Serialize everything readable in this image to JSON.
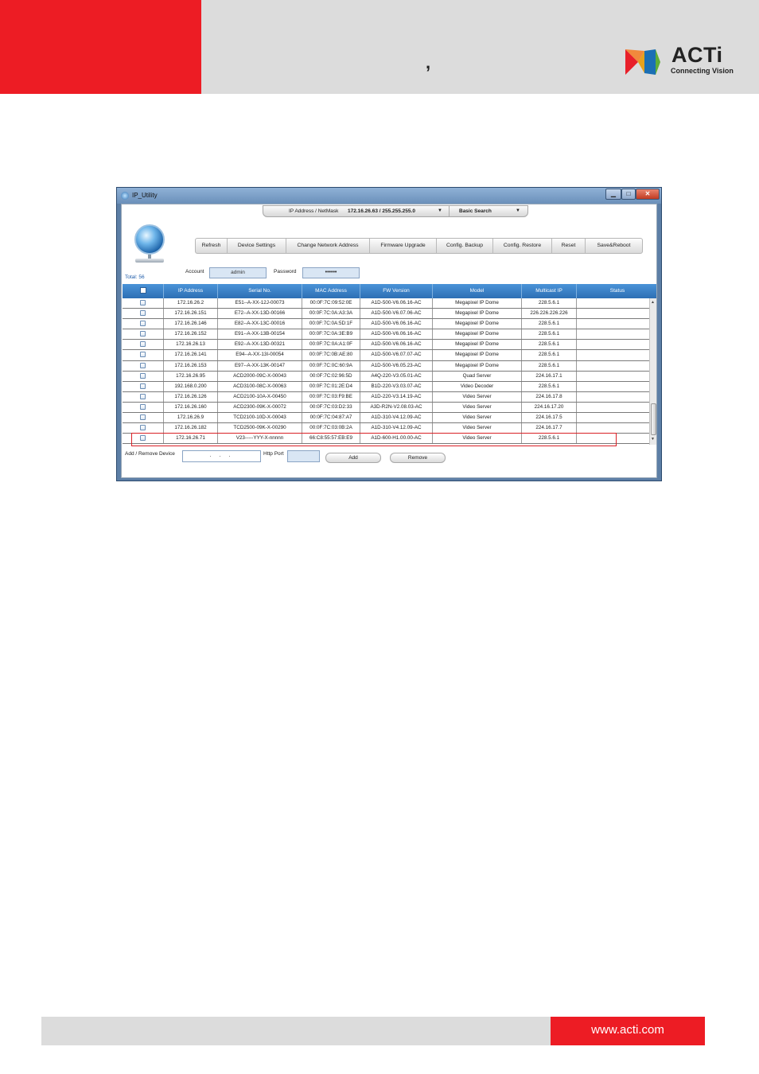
{
  "page": {
    "header_mark": ",",
    "logo": {
      "text": "ACTi",
      "tagline": "Connecting Vision"
    },
    "footer_url": "www.acti.com"
  },
  "window": {
    "title": "IP_Utility",
    "controls": {
      "minimize": "▁",
      "maximize": "□",
      "close": "✕"
    }
  },
  "network_bar": {
    "label": "IP Address / NetMask",
    "value": "172.16.26.63 / 255.255.255.0",
    "search_mode": "Basic Search"
  },
  "toolbar": {
    "buttons": [
      "Refresh",
      "Device Settings",
      "Change Network Address",
      "Firmware Upgrade",
      "Config. Backup",
      "Config. Restore",
      "Reset",
      "Save&Reboot"
    ]
  },
  "total_label": "Total: 56",
  "account": {
    "label": "Account",
    "value": "admin"
  },
  "password": {
    "label": "Password",
    "value": "••••••"
  },
  "table": {
    "columns": [
      "IP Address",
      "Serial No.",
      "MAC Address",
      "FW Version",
      "Model",
      "Multicast IP",
      "Status"
    ],
    "rows": [
      [
        "172.16.26.2",
        "E51--A-XX-12J-00073",
        "00:0F:7C:09:52:0E",
        "A1D-500-V6.06.16-AC",
        "Megapixel IP Dome",
        "228.5.6.1",
        ""
      ],
      [
        "172.16.26.151",
        "E72--A-XX-13D-00166",
        "00:0F:7C:0A:A3:3A",
        "A1D-500-V6.07.06-AC",
        "Megapixel IP Dome",
        "226.226.226.226",
        ""
      ],
      [
        "172.16.26.146",
        "E82--A-XX-13C-00016",
        "00:0F:7C:0A:5D:1F",
        "A1D-500-V6.06.16-AC",
        "Megapixel IP Dome",
        "228.5.6.1",
        ""
      ],
      [
        "172.16.26.152",
        "E91--A-XX-13B-00154",
        "00:0F:7C:0A:3E:B9",
        "A1D-500-V6.06.16-AC",
        "Megapixel IP Dome",
        "228.5.6.1",
        ""
      ],
      [
        "172.16.26.13",
        "E92--A-XX-13D-00321",
        "00:0F:7C:0A:A1:0F",
        "A1D-500-V6.06.16-AC",
        "Megapixel IP Dome",
        "228.5.6.1",
        ""
      ],
      [
        "172.16.26.141",
        "E94--A-XX-13I-00054",
        "00:0F:7C:0B:AE:80",
        "A1D-500-V6.07.07-AC",
        "Megapixel IP Dome",
        "228.5.6.1",
        ""
      ],
      [
        "172.16.26.153",
        "E97--A-XX-13K-00147",
        "00:0F:7C:0C:60:9A",
        "A1D-500-V6.05.23-AC",
        "Megapixel IP Dome",
        "228.5.6.1",
        ""
      ],
      [
        "172.16.26.95",
        "ACD2000-09C-X-00043",
        "00:0F:7C:02:96:5D",
        "A4Q-220-V3.05.01-AC",
        "Quad Server",
        "224.16.17.1",
        ""
      ],
      [
        "192.168.0.200",
        "ACD3100-08C-X-00063",
        "00:0F:7C:01:2E:D4",
        "B1D-220-V3.03.07-AC",
        "Video Decoder",
        "228.5.6.1",
        ""
      ],
      [
        "172.16.26.126",
        "ACD2100-10A-X-00450",
        "00:0F:7C:03:F9:BE",
        "A1D-220-V3.14.19-AC",
        "Video Server",
        "224.16.17.8",
        ""
      ],
      [
        "172.16.26.160",
        "ACD2300-09K-X-00072",
        "00:0F:7C:03:D2:33",
        "A3D-R2N-V2.08.03-AC",
        "Video Server",
        "224.16.17.20",
        ""
      ],
      [
        "172.16.26.9",
        "TCD2100-10D-X-00043",
        "00:0F:7C:04:87:A7",
        "A1D-310-V4.12.09-AC",
        "Video Server",
        "224.16.17.5",
        ""
      ],
      [
        "172.16.26.182",
        "TCD2500-09K-X-00290",
        "00:0F:7C:03:0B:2A",
        "A1D-310-V4.12.09-AC",
        "Video Server",
        "224.16.17.7",
        ""
      ],
      [
        "172.16.26.71",
        "V23-----YYY-X-nnnnn",
        "66:C8:55:57:EB:E9",
        "A1D-600-H1.00.00-AC",
        "Video Server",
        "228.5.6.1",
        ""
      ]
    ]
  },
  "add_remove": {
    "label": "Add / Remove Device",
    "ip_value": ". . .",
    "port_label": "Http Port",
    "add_label": "Add",
    "remove_label": "Remove"
  },
  "colors": {
    "brand_red": "#ed1c24",
    "header_blue": "#2d6fb4",
    "highlight": "#d92026"
  }
}
